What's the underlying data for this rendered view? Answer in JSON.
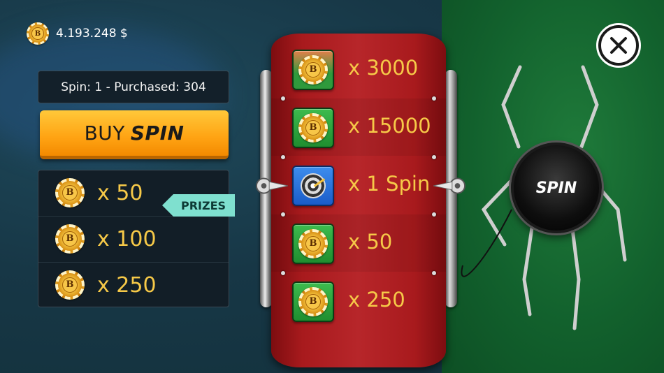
{
  "balance": {
    "amount": "4.193.248 $",
    "chip_letter": "B"
  },
  "spin_info": "Spin: 1 - Purchased: 304",
  "buy_button": {
    "label_main": "BUY",
    "label_bold": "SPIN"
  },
  "prizes_panel": {
    "items": [
      {
        "label": "x 50",
        "icon": "coin-icon"
      },
      {
        "label": "x 100",
        "icon": "coin-icon"
      },
      {
        "label": "x 250",
        "icon": "coin-icon"
      }
    ],
    "tag": "PRIZES"
  },
  "wheel": {
    "slots": [
      {
        "label": "x 3000",
        "icon": "coin-icon",
        "tile": "green"
      },
      {
        "label": "x 15000",
        "icon": "coin-icon",
        "tile": "green"
      },
      {
        "label": "x 1 Spin",
        "icon": "target-icon",
        "tile": "blue"
      },
      {
        "label": "x 50",
        "icon": "coin-icon",
        "tile": "green"
      },
      {
        "label": "x 250",
        "icon": "coin-icon",
        "tile": "green"
      }
    ]
  },
  "spin_button": "SPIN",
  "close_button": "close-icon",
  "colors": {
    "accent_gold": "#f6c948",
    "buy_orange": "#ffa313",
    "drum_red": "#b7262a",
    "felt_green": "#12612d",
    "tag_teal": "#7fe0cf"
  }
}
